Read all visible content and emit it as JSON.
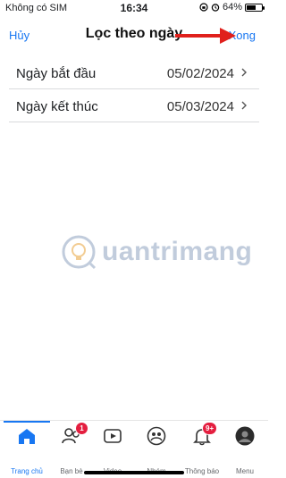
{
  "status_bar": {
    "carrier": "Không có SIM",
    "time": "16:34",
    "battery": "64%",
    "battery_level": 0.64
  },
  "nav": {
    "cancel_label": "Hủy",
    "title": "Lọc theo ngày",
    "done_label": "Xong"
  },
  "rows": [
    {
      "label": "Ngày bắt đầu",
      "value": "05/02/2024"
    },
    {
      "label": "Ngày kết thúc",
      "value": "05/03/2024"
    }
  ],
  "watermark": "uantrimang",
  "tabs": [
    {
      "label": "Trang chủ",
      "icon": "home-icon",
      "active": true
    },
    {
      "label": "Bạn bè",
      "icon": "friends-icon",
      "badge": "1"
    },
    {
      "label": "Video",
      "icon": "video-icon"
    },
    {
      "label": "Nhóm",
      "icon": "groups-icon"
    },
    {
      "label": "Thông báo",
      "icon": "bell-icon",
      "badge": "9+"
    },
    {
      "label": "Menu",
      "icon": "avatar"
    }
  ],
  "colors": {
    "accent": "#1877f2",
    "badge": "#e41e3f",
    "arrow": "#e0201c"
  }
}
